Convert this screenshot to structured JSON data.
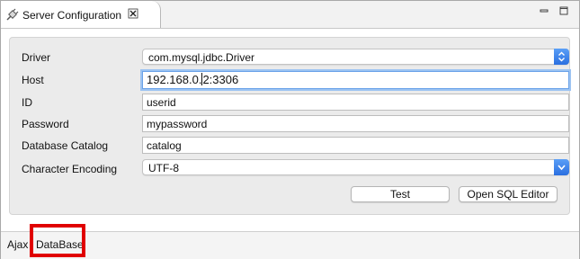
{
  "tab": {
    "title": "Server Configuration",
    "icon": "plug-connector-icon",
    "close_icon": "close-icon"
  },
  "form": {
    "driver": {
      "label": "Driver",
      "value": "com.mysql.jdbc.Driver"
    },
    "host": {
      "label": "Host",
      "value_before_caret": "192.168.0.",
      "value_after_caret": "2:3306"
    },
    "id": {
      "label": "ID",
      "value": "userid"
    },
    "password": {
      "label": "Password",
      "value": "mypassword"
    },
    "catalog": {
      "label": "Database Catalog",
      "value": "catalog"
    },
    "encoding": {
      "label": "Character Encoding",
      "value": "UTF-8"
    }
  },
  "buttons": {
    "test": "Test",
    "open_sql_editor": "Open SQL Editor"
  },
  "bottom_tabs": {
    "ajax": "Ajax",
    "database": "DataBase"
  },
  "colors": {
    "highlight": "#e00000",
    "select_arrow": "#2a6fe0",
    "focus_ring": "#9cc3f2"
  }
}
